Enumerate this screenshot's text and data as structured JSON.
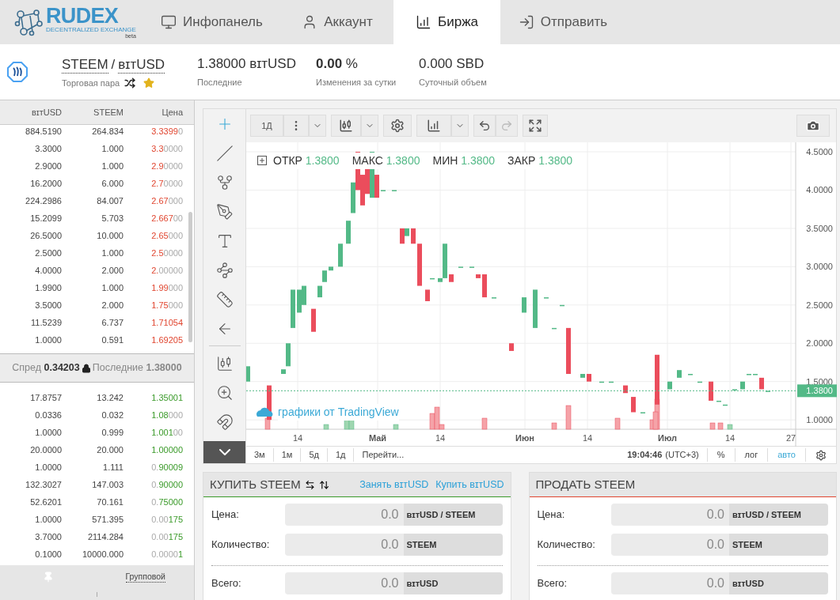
{
  "header": {
    "logo": {
      "name": "RUDEX",
      "tagline": "DECENTRALIZED EXCHANGE",
      "badge": "beta"
    },
    "tabs": [
      {
        "label": "Инфопанель",
        "selected": false
      },
      {
        "label": "Аккаунт",
        "selected": false
      },
      {
        "label": "Биржа",
        "selected": true
      },
      {
        "label": "Отправить",
        "selected": false
      }
    ]
  },
  "ticker": {
    "pair": {
      "base": "STEEM",
      "separator": "/",
      "quote": "ʙɪᴛUSD",
      "caption": "Торговая пара",
      "favorite": true
    },
    "stats": [
      {
        "value": "1.38000 ʙɪᴛUSD",
        "caption": "Последние"
      },
      {
        "value": "**0.00** %",
        "caption": "Изменения за сутки"
      },
      {
        "value": "0.000 SBD",
        "caption": "Суточный объем"
      }
    ]
  },
  "order_book": {
    "columns": [
      "ʙɪᴛUSD",
      "STEEM",
      "Цена"
    ],
    "asks": [
      {
        "total": "884.5190",
        "amount": "264.834",
        "price_parts": [
          {
            "text": "3.3399",
            "dim": false
          },
          {
            "text": "0",
            "dim": true
          }
        ]
      },
      {
        "total": "3.3000",
        "amount": "1.000",
        "price_parts": [
          {
            "text": "3.3",
            "dim": false
          },
          {
            "text": "0000",
            "dim": true
          }
        ]
      },
      {
        "total": "2.9000",
        "amount": "1.000",
        "price_parts": [
          {
            "text": "2.9",
            "dim": false
          },
          {
            "text": "0000",
            "dim": true
          }
        ]
      },
      {
        "total": "16.2000",
        "amount": "6.000",
        "price_parts": [
          {
            "text": "2.7",
            "dim": false
          },
          {
            "text": "0000",
            "dim": true
          }
        ]
      },
      {
        "total": "224.2986",
        "amount": "84.007",
        "price_parts": [
          {
            "text": "2.67",
            "dim": false
          },
          {
            "text": "000",
            "dim": true
          }
        ]
      },
      {
        "total": "15.2099",
        "amount": "5.703",
        "price_parts": [
          {
            "text": "2.667",
            "dim": false
          },
          {
            "text": "00",
            "dim": true
          }
        ]
      },
      {
        "total": "26.5000",
        "amount": "10.000",
        "price_parts": [
          {
            "text": "2.65",
            "dim": false
          },
          {
            "text": "000",
            "dim": true
          }
        ]
      },
      {
        "total": "2.5000",
        "amount": "1.000",
        "price_parts": [
          {
            "text": "2.5",
            "dim": false
          },
          {
            "text": "0000",
            "dim": true
          }
        ]
      },
      {
        "total": "4.0000",
        "amount": "2.000",
        "price_parts": [
          {
            "text": "2.",
            "dim": false
          },
          {
            "text": "00000",
            "dim": true
          }
        ]
      },
      {
        "total": "1.9900",
        "amount": "1.000",
        "price_parts": [
          {
            "text": "1.99",
            "dim": false
          },
          {
            "text": "000",
            "dim": true
          }
        ]
      },
      {
        "total": "3.5000",
        "amount": "2.000",
        "price_parts": [
          {
            "text": "1.75",
            "dim": false
          },
          {
            "text": "000",
            "dim": true
          }
        ]
      },
      {
        "total": "11.5239",
        "amount": "6.737",
        "price_parts": [
          {
            "text": "1.71054",
            "dim": false
          }
        ]
      },
      {
        "total": "1.0000",
        "amount": "0.591",
        "price_parts": [
          {
            "text": "1.69205",
            "dim": false
          }
        ]
      }
    ],
    "spread": "Спред **0.34203**",
    "last": "Последние **1.38000**",
    "bids": [
      {
        "total": "17.8757",
        "amount": "13.242",
        "price_parts": [
          {
            "text": "1.35001",
            "dim": false
          }
        ]
      },
      {
        "total": "0.0336",
        "amount": "0.032",
        "price_parts": [
          {
            "text": "1.08",
            "dim": false
          },
          {
            "text": "000",
            "dim": true
          }
        ]
      },
      {
        "total": "1.0000",
        "amount": "0.999",
        "price_parts": [
          {
            "text": "1.001",
            "dim": false
          },
          {
            "text": "00",
            "dim": true
          }
        ]
      },
      {
        "total": "20.0000",
        "amount": "20.000",
        "price_parts": [
          {
            "text": "1.00000",
            "dim": false
          }
        ]
      },
      {
        "total": "1.0000",
        "amount": "1.111",
        "price_parts": [
          {
            "text": "0.",
            "dim": true
          },
          {
            "text": "90009",
            "dim": false
          }
        ]
      },
      {
        "total": "132.3027",
        "amount": "147.003",
        "price_parts": [
          {
            "text": "0.",
            "dim": true
          },
          {
            "text": "90000",
            "dim": false
          }
        ]
      },
      {
        "total": "52.6201",
        "amount": "70.161",
        "price_parts": [
          {
            "text": "0.",
            "dim": true
          },
          {
            "text": "75000",
            "dim": false
          }
        ]
      },
      {
        "total": "1.0000",
        "amount": "571.395",
        "price_parts": [
          {
            "text": "0.00",
            "dim": true
          },
          {
            "text": "175",
            "dim": false
          }
        ]
      },
      {
        "total": "3.7000",
        "amount": "2114.284",
        "price_parts": [
          {
            "text": "0.00",
            "dim": true
          },
          {
            "text": "175",
            "dim": false
          }
        ]
      },
      {
        "total": "0.1000",
        "amount": "10000.000",
        "price_parts": [
          {
            "text": "0.0000",
            "dim": true
          },
          {
            "text": "1",
            "dim": false
          }
        ]
      }
    ],
    "footer": {
      "grouping": "Групповой"
    }
  },
  "chart": {
    "interval": "1Д",
    "drawing_tools": [
      {
        "selected": true
      },
      {
        "selected": false
      },
      {
        "selected": false
      },
      {
        "selected": false
      },
      {
        "selected": false
      },
      {
        "selected": false
      },
      {
        "selected": false
      },
      {
        "selected": false
      },
      {
        "selected": false
      },
      {
        "selected": false
      },
      {
        "selected": false
      }
    ],
    "legend": [
      {
        "label": "ОТКР",
        "value": "1.3800"
      },
      {
        "label": "МАКС",
        "value": "1.3800"
      },
      {
        "label": "МИН",
        "value": "1.3800"
      },
      {
        "label": "ЗАКР",
        "value": "1.3800"
      }
    ],
    "watermark": "графики от TradingView",
    "y_labels": [
      "4.5000",
      "4.0000",
      "3.5000",
      "3.0000",
      "2.5000",
      "2.0000",
      "1.5000",
      "1.0000"
    ],
    "last_price": "1.3800",
    "x_labels": [
      {
        "text": "14",
        "bold": false
      },
      {
        "text": "Май",
        "bold": true
      },
      {
        "text": "14",
        "bold": false
      },
      {
        "text": "Июн",
        "bold": true
      },
      {
        "text": "14",
        "bold": false
      },
      {
        "text": "Июл",
        "bold": true
      },
      {
        "text": "14",
        "bold": false
      },
      {
        "text": "27",
        "bold": false
      }
    ],
    "bottom_bar": {
      "ranges": [
        "3м",
        "1м",
        "5д",
        "1д"
      ],
      "goto": "Перейти...",
      "time": "19:04:46",
      "timezone": "(UTC+3)",
      "options": [
        {
          "label": "%",
          "selected": false
        },
        {
          "label": "лог",
          "selected": false
        },
        {
          "label": "авто",
          "selected": true
        }
      ]
    }
  },
  "forms": [
    {
      "color": "#3a9a29",
      "title": "КУПИТЬ STEEM",
      "links": [
        "Занять ʙɪᴛUSD",
        "Купить ʙɪᴛUSD"
      ],
      "fields": [
        {
          "label": "Цена:",
          "placeholder": "0.0",
          "unit": "ʙɪᴛUSD / STEEM"
        },
        {
          "label": "Количество:",
          "placeholder": "0.0",
          "unit": "STEEM"
        },
        {
          "label": "Всего:",
          "placeholder": "0.0",
          "unit": "ʙɪᴛUSD"
        }
      ]
    },
    {
      "color": "#e0452f",
      "title": "ПРОДАТЬ STEEM",
      "fields": [
        {
          "label": "Цена:",
          "placeholder": "0.0",
          "unit": "ʙɪᴛUSD / STEEM"
        },
        {
          "label": "Количество:",
          "placeholder": "0.0",
          "unit": "STEEM"
        },
        {
          "label": "Всего:",
          "placeholder": "0.0",
          "unit": "ʙɪᴛUSD"
        }
      ]
    }
  ]
}
